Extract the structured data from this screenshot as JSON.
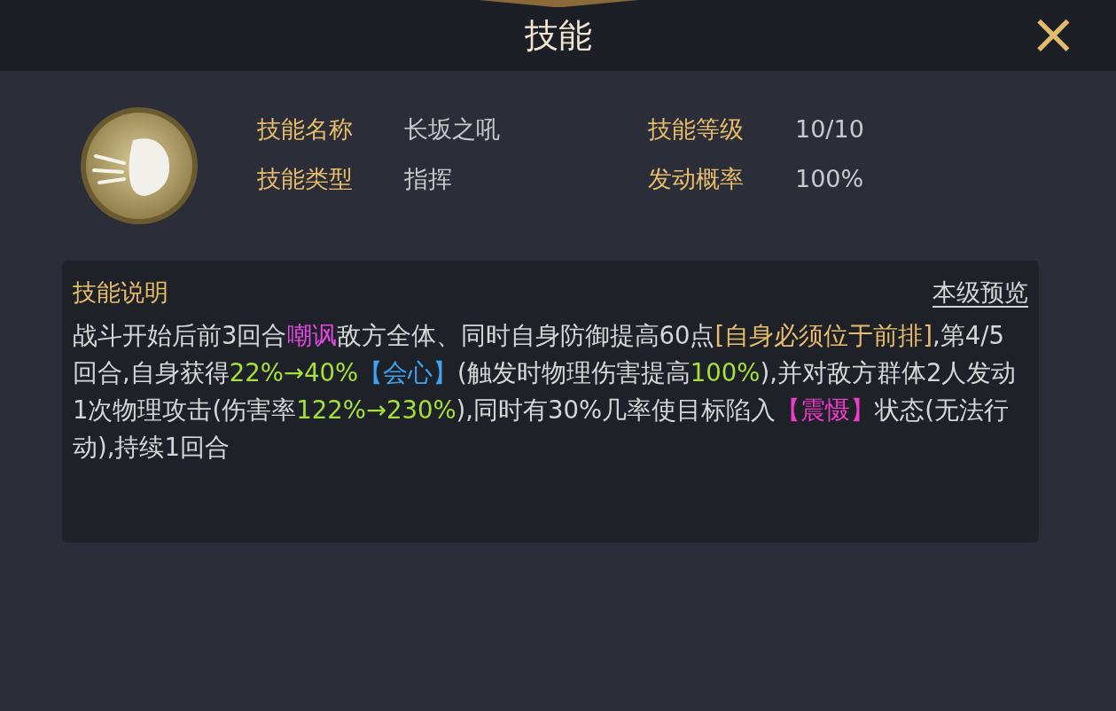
{
  "window": {
    "title": "技能",
    "close": "×"
  },
  "skill_info": [
    {
      "label": "技能名称",
      "value": "长坂之吼"
    },
    {
      "label": "技能等级",
      "value": "10/10"
    },
    {
      "label": "技能类型",
      "value": "指挥"
    },
    {
      "label": "发动概率",
      "value": "100%"
    }
  ],
  "description": {
    "title": "技能说明",
    "preview_link": "本级预览",
    "segments": [
      {
        "text": "战斗开始后前3回合",
        "color": "#d6d6d6"
      },
      {
        "text": "嘲讽",
        "color": "#e04ae0"
      },
      {
        "text": "敌方全体、同时自身防御提高60点",
        "color": "#d6d6d6"
      },
      {
        "text": "[自身必须位于前排]",
        "color": "#e8bd6a"
      },
      {
        "text": ",第4/5回合,自身获得",
        "color": "#d6d6d6"
      },
      {
        "text": "22%→40%",
        "color": "#a6e03a"
      },
      {
        "text": "【会心】",
        "color": "#3fa2f0"
      },
      {
        "text": "(触发时物理伤害提高",
        "color": "#d6d6d6"
      },
      {
        "text": "100%",
        "color": "#a6e03a"
      },
      {
        "text": "),并对敌方群体2人发动1次物理攻击(伤害率",
        "color": "#d6d6d6"
      },
      {
        "text": "122%→230%",
        "color": "#a6e03a"
      },
      {
        "text": ")",
        "color": "#d6d6d6"
      },
      {
        "text": ",同时有30%几率使目标陷入",
        "color": "#d6d6d6"
      },
      {
        "text": "【震慑】",
        "color": "#f03ac8"
      },
      {
        "text": "状态(无法行动),持续1回合",
        "color": "#d6d6d6"
      }
    ]
  }
}
